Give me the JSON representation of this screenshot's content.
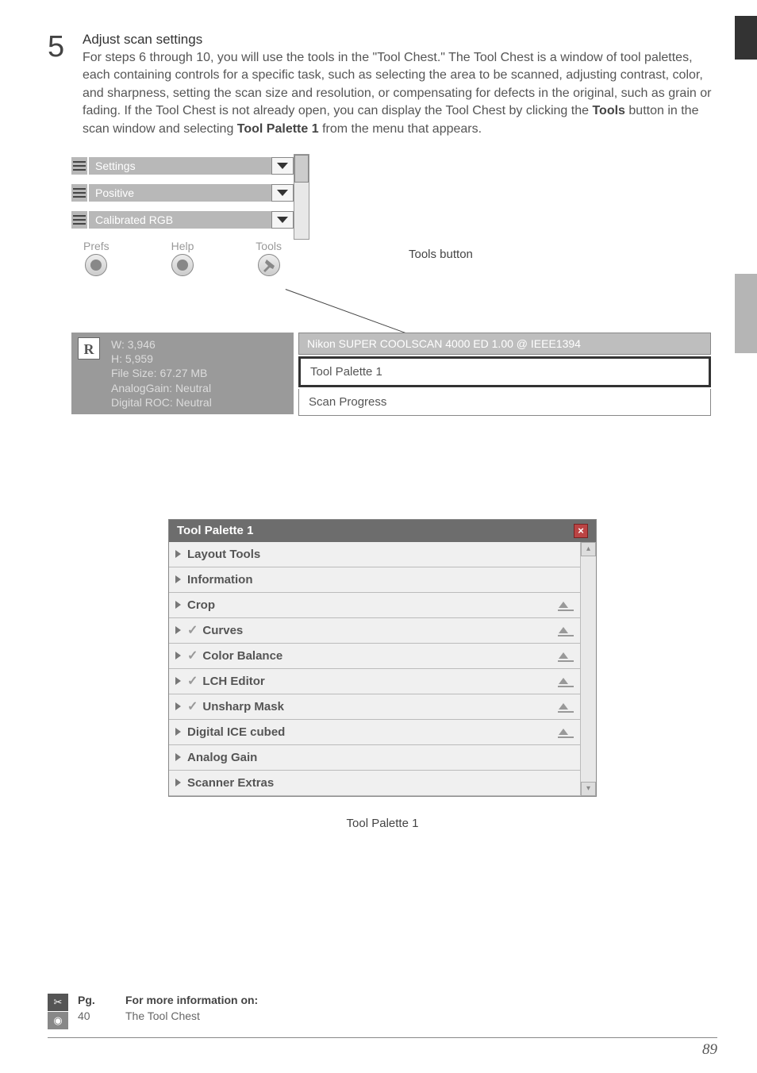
{
  "step": {
    "number": "5",
    "title": "Adjust scan settings",
    "description": "For steps 6 through 10, you will use the tools in the \"Tool Chest.\"  The Tool Chest is a window of tool palettes, each containing controls for a specific task, such as selecting the area to be scanned, adjusting contrast, color, and sharpness, setting the scan size and resolution, or compensating for defects in the original, such as grain or fading.  If the Tool Chest is not already open, you can display the Tool Chest by clicking the ",
    "bold1": "Tools",
    "mid": " button in the scan window and selecting ",
    "bold2": "Tool Palette 1",
    "tail": " from the menu that appears."
  },
  "combos": {
    "settings": "Settings",
    "positive": "Positive",
    "calibrated": "Calibrated RGB"
  },
  "helpRow": {
    "prefs": "Prefs",
    "help": "Help",
    "tools": "Tools"
  },
  "rblock": {
    "letter": "R",
    "w": "W: 3,946",
    "h": "H: 5,959",
    "size": "File Size: 67.27 MB",
    "analog": "AnalogGain: Neutral",
    "roc": "Digital ROC: Neutral"
  },
  "toolsButton": "Tools button",
  "menu": {
    "header": "Nikon SUPER COOLSCAN 4000 ED 1.00 @ IEEE1394",
    "item1": "Tool Palette 1",
    "item2": "Scan Progress"
  },
  "palette": {
    "title": "Tool Palette 1",
    "rows": [
      {
        "label": "Layout Tools",
        "check": false,
        "reset": false
      },
      {
        "label": "Information",
        "check": false,
        "reset": false
      },
      {
        "label": "Crop",
        "check": false,
        "reset": true
      },
      {
        "label": "Curves",
        "check": true,
        "reset": true
      },
      {
        "label": "Color Balance",
        "check": true,
        "reset": true
      },
      {
        "label": "LCH Editor",
        "check": true,
        "reset": true
      },
      {
        "label": "Unsharp Mask",
        "check": true,
        "reset": true
      },
      {
        "label": "Digital ICE cubed",
        "check": false,
        "reset": true
      },
      {
        "label": "Analog Gain",
        "check": false,
        "reset": false
      },
      {
        "label": "Scanner Extras",
        "check": false,
        "reset": false
      }
    ]
  },
  "caption": "Tool Palette 1",
  "footer": {
    "pgHdr": "Pg.",
    "infoHdr": "For more information on:",
    "pg": "40",
    "topic": "The Tool Chest"
  },
  "pageNum": "89"
}
